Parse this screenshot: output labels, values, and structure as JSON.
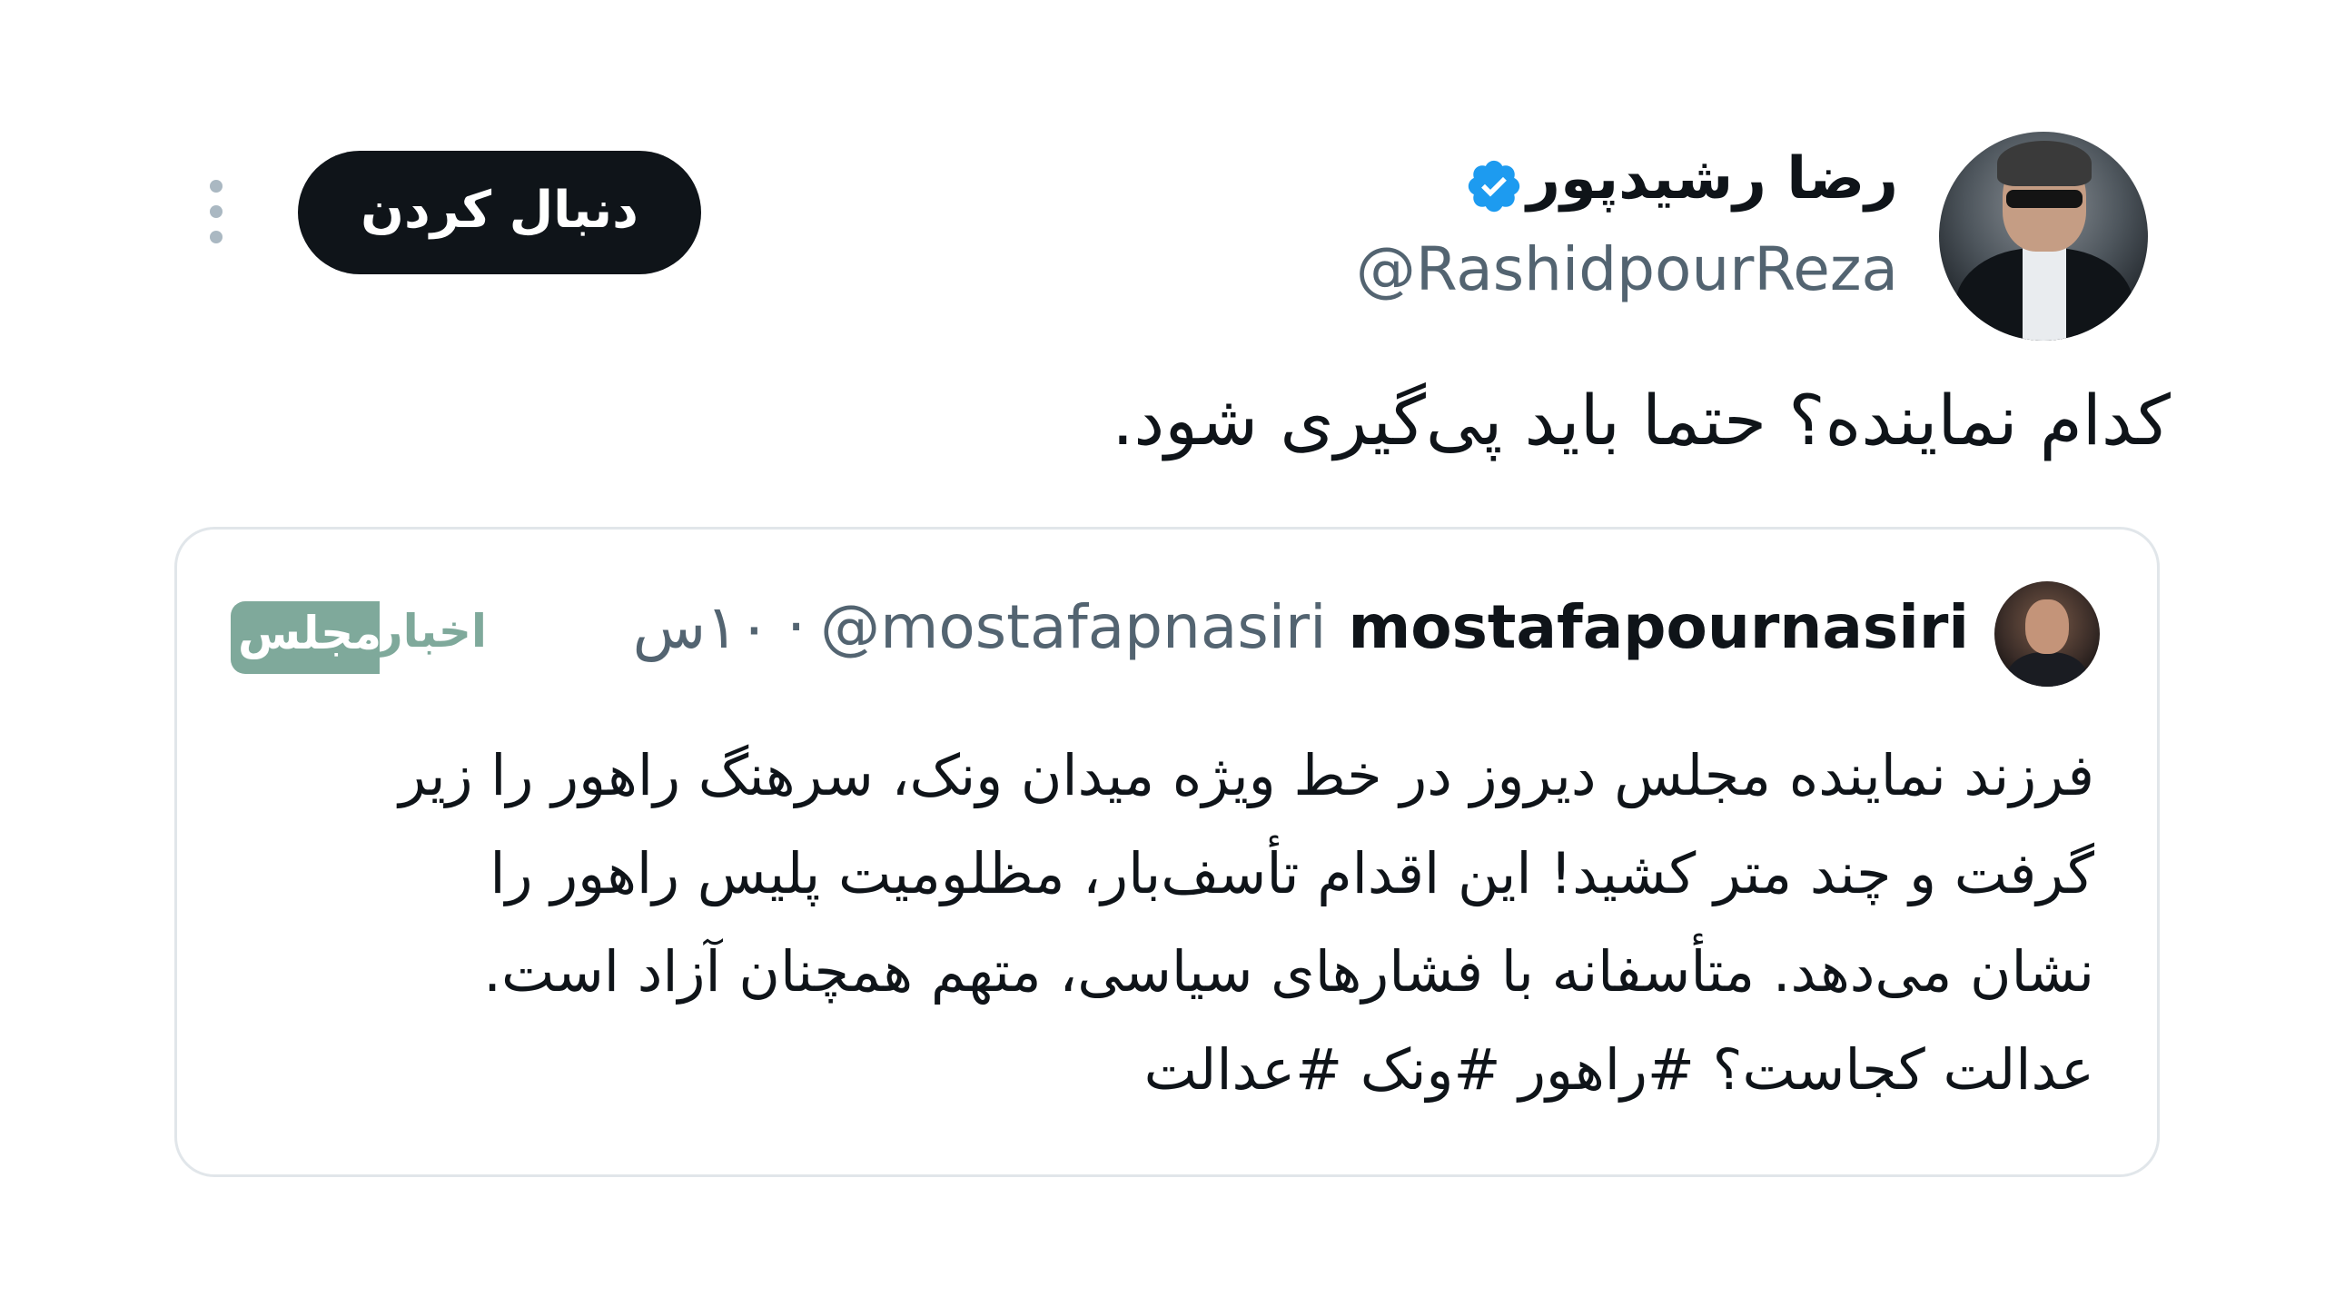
{
  "author": {
    "display_name": "رضا رشیدپور",
    "handle": "@RashidpourReza",
    "verified": true
  },
  "actions": {
    "follow_label": "دنبال کردن",
    "more_icon": "more-vertical-icon"
  },
  "tweet": {
    "text": "کدام نماینده؟ حتما باید پی‌گیری شود."
  },
  "quote": {
    "name": "mostafapournasiri",
    "handle": "@mostafapnasiri",
    "separator": "·",
    "time": "۱۰س",
    "lines": [
      "فرزند نماینده مجلس دیروز در خط ویژه میدان ونک، سرهنگ راهور را زیر",
      "گرفت و چند متر کشید! این اقدام تأسف‌بار، مظلومیت پلیس راهور را",
      "نشان می‌دهد. متأسفانه با فشارهای سیاسی، متهم همچنان آزاد است.",
      "عدالت کجاست؟ #راهور #ونک #عدالت"
    ]
  },
  "watermark": {
    "word1": "اخبار",
    "word2": "مجلس",
    "color": "#7fa99b"
  },
  "colors": {
    "text": "#0f1419",
    "secondary": "#536471",
    "verified": "#1d9bf0",
    "border": "#e1e6ea"
  }
}
